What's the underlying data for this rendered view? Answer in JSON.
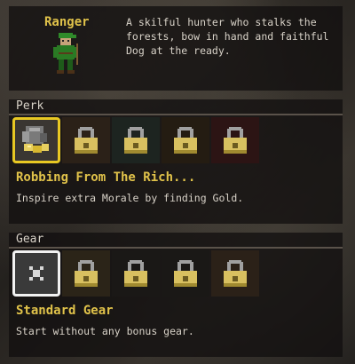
{
  "character": {
    "name": "Ranger",
    "description": "A skilful hunter who stalks the forests, bow in hand and faithful Dog at the ready."
  },
  "perk": {
    "section_title": "Perk",
    "selected_title": "Robbing From The Rich...",
    "selected_description": "Inspire extra Morale by finding Gold.",
    "slots": [
      {
        "icon": "gold-sack-icon",
        "locked": false,
        "selected": true
      },
      {
        "icon": "lock-icon",
        "locked": true,
        "selected": false
      },
      {
        "icon": "lock-icon",
        "locked": true,
        "selected": false
      },
      {
        "icon": "lock-icon",
        "locked": true,
        "selected": false
      },
      {
        "icon": "lock-icon",
        "locked": true,
        "selected": false
      }
    ]
  },
  "gear": {
    "section_title": "Gear",
    "selected_title": "Standard Gear",
    "selected_description": "Start without any bonus gear.",
    "slots": [
      {
        "icon": "crossed-x-icon",
        "locked": false,
        "selected": true
      },
      {
        "icon": "lock-icon",
        "locked": true,
        "selected": false
      },
      {
        "icon": "lock-icon",
        "locked": true,
        "selected": false
      },
      {
        "icon": "lock-icon",
        "locked": true,
        "selected": false
      },
      {
        "icon": "lock-icon",
        "locked": true,
        "selected": false
      }
    ]
  },
  "colors": {
    "accent_gold": "#e0c24a",
    "selected_gold_border": "#e8c823",
    "selected_white_border": "#f2f2f2",
    "text": "#d8d2c8"
  }
}
